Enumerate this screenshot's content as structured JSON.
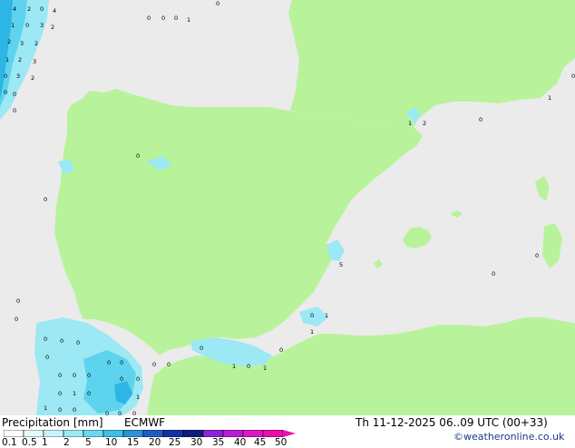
{
  "title": "Precipitation [mm]",
  "model": "ECMWF",
  "valid_time": "Th 11-12-2025 06..09 UTC (00+33)",
  "credit": "©weatheronline.co.uk",
  "colors": {
    "sea": "#ebebeb",
    "land": "#b8f39c",
    "precip_light": "#9ce8f4",
    "precip_mid": "#5ed3ee",
    "precip_strong": "#2cb6e6"
  },
  "legend": {
    "ticks": [
      "0.1",
      "0.5",
      "1",
      "2",
      "5",
      "10",
      "15",
      "20",
      "25",
      "30",
      "35",
      "40",
      "45",
      "50"
    ],
    "colors": [
      "#ffffff",
      "#e6fbfd",
      "#c8f4fa",
      "#9ce8f4",
      "#6cd8ef",
      "#3cc0e8",
      "#2a93d8",
      "#1e5ec4",
      "#1631a8",
      "#101c7c",
      "#8c22d8",
      "#b81ed8",
      "#da18c8",
      "#e810a8"
    ]
  },
  "markers": [
    {
      "t": "4"
    },
    {
      "t": "2"
    },
    {
      "t": "0"
    },
    {
      "t": "4"
    },
    {
      "t": "1"
    },
    {
      "t": "0"
    },
    {
      "t": "3"
    },
    {
      "t": "2"
    },
    {
      "t": "2"
    },
    {
      "t": "3"
    },
    {
      "t": "2"
    },
    {
      "t": "1"
    },
    {
      "t": "2"
    },
    {
      "t": "3"
    },
    {
      "t": "0"
    },
    {
      "t": "3"
    },
    {
      "t": "2"
    },
    {
      "t": "0"
    },
    {
      "t": "0"
    },
    {
      "t": "0"
    },
    {
      "t": "0"
    },
    {
      "t": "0"
    },
    {
      "t": "0"
    },
    {
      "t": "1"
    },
    {
      "t": "0"
    },
    {
      "t": "0"
    },
    {
      "t": "0"
    },
    {
      "t": "0"
    },
    {
      "t": "0"
    },
    {
      "t": "0"
    },
    {
      "t": "0"
    },
    {
      "t": "0"
    },
    {
      "t": "0"
    },
    {
      "t": "0"
    },
    {
      "t": "0"
    },
    {
      "t": "0"
    },
    {
      "t": "0"
    },
    {
      "t": "0"
    },
    {
      "t": "0"
    },
    {
      "t": "0"
    },
    {
      "t": "0"
    },
    {
      "t": "1"
    },
    {
      "t": "0"
    },
    {
      "t": "1"
    },
    {
      "t": "0"
    },
    {
      "t": "0"
    },
    {
      "t": "0"
    },
    {
      "t": "0"
    },
    {
      "t": "0"
    },
    {
      "t": "1"
    },
    {
      "t": "0"
    },
    {
      "t": "0"
    },
    {
      "t": "0"
    },
    {
      "t": "1"
    },
    {
      "t": "0"
    },
    {
      "t": "1"
    },
    {
      "t": "0"
    },
    {
      "t": "0"
    },
    {
      "t": "1"
    },
    {
      "t": "1"
    },
    {
      "t": "5"
    },
    {
      "t": "1"
    },
    {
      "t": "2"
    },
    {
      "t": "0"
    },
    {
      "t": "1"
    },
    {
      "t": "0"
    },
    {
      "t": "0"
    },
    {
      "t": "0"
    }
  ]
}
